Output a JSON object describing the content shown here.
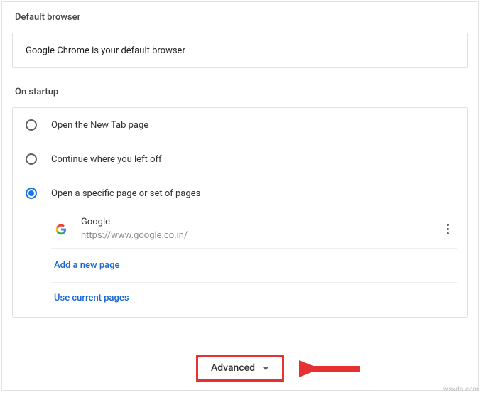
{
  "sections": {
    "default_browser": {
      "heading": "Default browser",
      "status": "Google Chrome is your default browser"
    },
    "on_startup": {
      "heading": "On startup",
      "options": {
        "new_tab": "Open the New Tab page",
        "continue": "Continue where you left off",
        "specific": "Open a specific page or set of pages"
      },
      "pages": [
        {
          "title": "Google",
          "url": "https://www.google.co.in/"
        }
      ],
      "add_page": "Add a new page",
      "use_current": "Use current pages"
    }
  },
  "advanced": {
    "label": "Advanced"
  },
  "watermark": "wsxdn.com"
}
